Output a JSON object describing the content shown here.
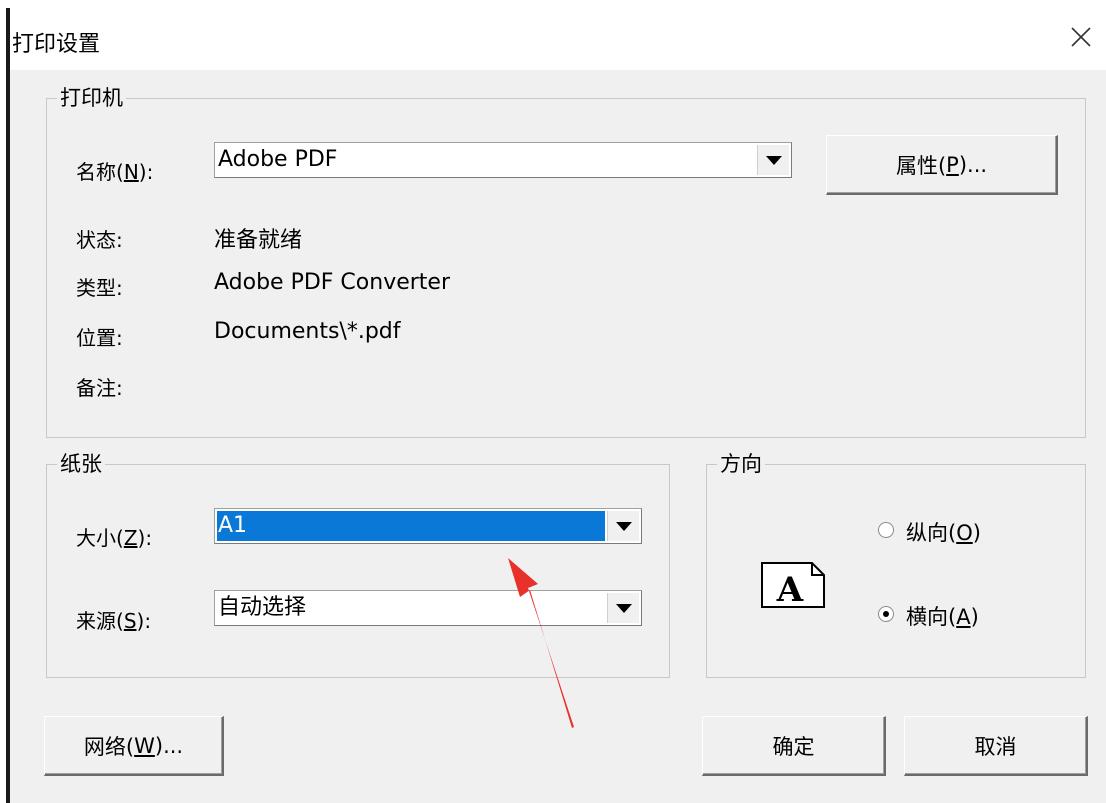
{
  "dialog": {
    "title": "打印设置"
  },
  "printer": {
    "group_label": "打印机",
    "name_label": "名称(",
    "name_accel": "N",
    "name_label_end": "):",
    "name_value": "Adobe PDF",
    "properties_button": "属性(",
    "properties_accel": "P",
    "properties_button_end": ")...",
    "status_label": "状态:",
    "status_value": "准备就绪",
    "type_label": "类型:",
    "type_value": "Adobe PDF Converter",
    "location_label": "位置:",
    "location_value": "Documents\\*.pdf",
    "comment_label": "备注:",
    "comment_value": ""
  },
  "paper": {
    "group_label": "纸张",
    "size_label": "大小(",
    "size_accel": "Z",
    "size_label_end": "):",
    "size_value": "A1",
    "source_label": "来源(",
    "source_accel": "S",
    "source_label_end": "):",
    "source_value": "自动选择"
  },
  "orientation": {
    "group_label": "方向",
    "portrait_label": "纵向(",
    "portrait_accel": "O",
    "portrait_label_end": ")",
    "portrait_checked": false,
    "landscape_label": "横向(",
    "landscape_accel": "A",
    "landscape_label_end": ")",
    "landscape_checked": true,
    "preview_letter": "A"
  },
  "footer": {
    "network_button": "网络(",
    "network_accel": "W",
    "network_button_end": ")...",
    "ok_button": "确定",
    "cancel_button": "取消"
  },
  "icons": {
    "close": "close-icon",
    "dropdown": "chevron-down-icon",
    "orientation_preview": "page-orientation-icon",
    "annotation": "red-arrow-annotation"
  },
  "colors": {
    "dialog_bg": "#f0f0f0",
    "selection": "#0a78d7",
    "annotation_arrow": "#e8312a"
  }
}
